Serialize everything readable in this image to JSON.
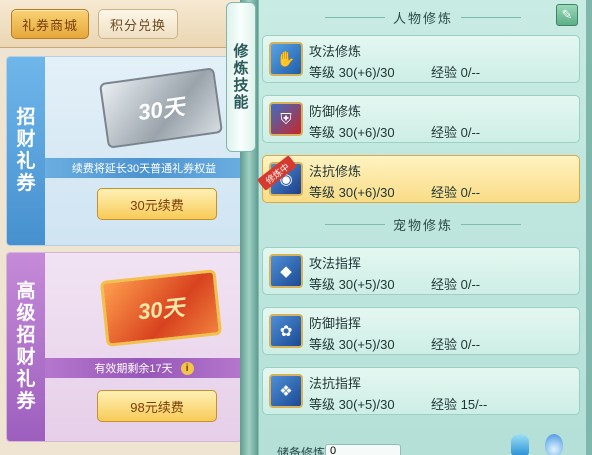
{
  "tabs": [
    {
      "label": "礼券商城"
    },
    {
      "label": "积分兑换"
    }
  ],
  "vouchers": [
    {
      "vlabel": [
        "招",
        "财",
        "礼",
        "券"
      ],
      "ticket_text": "30天",
      "caption": "续费将延长30天普通礼券权益",
      "button": "30元续费"
    },
    {
      "vlabel": [
        "高",
        "级",
        "招",
        "财",
        "礼",
        "券"
      ],
      "ticket_text": "30天",
      "caption": "有效期剩余17天",
      "button": "98元续费"
    }
  ],
  "skill_scroll": [
    "修",
    "炼",
    "技",
    "能"
  ],
  "sections": {
    "character": "人物修炼",
    "pet": "宠物修炼"
  },
  "character_rows": [
    {
      "name": "攻法修炼",
      "level": "等级 30(+6)/30",
      "exp": "经验 0/--",
      "icon": "attack-magic-icon"
    },
    {
      "name": "防御修炼",
      "level": "等级 30(+6)/30",
      "exp": "经验 0/--",
      "icon": "defense-shield-icon"
    },
    {
      "name": "法抗修炼",
      "level": "等级 30(+6)/30",
      "exp": "经验 0/--",
      "icon": "magic-resist-icon",
      "badge": "修炼中",
      "active": true
    }
  ],
  "pet_rows": [
    {
      "name": "攻法指挥",
      "level": "等级 30(+5)/30",
      "exp": "经验 0/--",
      "icon": "pet-attack-icon"
    },
    {
      "name": "防御指挥",
      "level": "等级 30(+5)/30",
      "exp": "经验 0/--",
      "icon": "pet-defense-icon"
    },
    {
      "name": "法抗指挥",
      "level": "等级 30(+5)/30",
      "exp": "经验 15/--",
      "icon": "pet-resist-icon"
    }
  ],
  "bottom": {
    "label": "储备修炼",
    "value": "0"
  }
}
